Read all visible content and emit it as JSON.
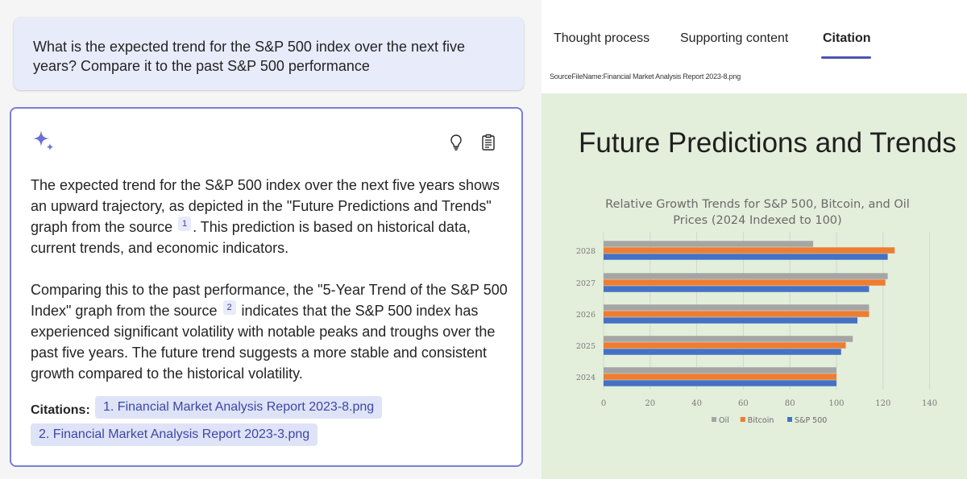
{
  "question": "What is the expected trend for the S&P 500 index over the next five years? Compare it to the past S&P 500 performance",
  "answer": {
    "icons": {
      "sparkle": "sparkle-icon",
      "thought": "lightbulb-icon",
      "supporting": "clipboard-icon"
    },
    "p1_before": "The expected trend for the S&P 500 index over the next five years shows an upward trajectory, as depicted in the \"Future Predictions and Trends\" graph from the source ",
    "p1_ref": "1",
    "p1_after": ". This prediction is based on historical data, current trends, and economic indicators.",
    "p2_before": "Comparing this to the past performance, the \"5-Year Trend of the S&P 500 Index\" graph from the source ",
    "p2_ref": "2",
    "p2_after": " indicates that the S&P 500 index has experienced significant volatility with notable peaks and troughs over the past five years. The future trend suggests a more stable and consistent growth compared to the historical volatility.",
    "citations_label": "Citations:",
    "citations": [
      "1. Financial Market Analysis Report 2023-8.png",
      "2. Financial Market Analysis Report 2023-3.png"
    ]
  },
  "panel": {
    "tabs": [
      "Thought process",
      "Supporting content",
      "Citation"
    ],
    "active_tab": "Citation",
    "source_line": "SourceFileName:Financial Market Analysis Report 2023-8.png",
    "slide_title": "Future Predictions and Trends",
    "accent": "#4f52b2"
  },
  "chart_data": {
    "type": "bar",
    "orientation": "horizontal",
    "title": "Relative Growth Trends for S&P 500, Bitcoin, and Oil Prices (2024 Indexed to 100)",
    "title_lines": [
      "Relative Growth Trends for S&P 500, Bitcoin, and Oil",
      "Prices (2024 Indexed to 100)"
    ],
    "categories": [
      "2024",
      "2025",
      "2026",
      "2027",
      "2028"
    ],
    "series": [
      {
        "name": "Oil",
        "color": "#a5a5a5",
        "values": [
          100,
          107,
          114,
          122,
          90
        ]
      },
      {
        "name": "Bitcoin",
        "color": "#ed7d31",
        "values": [
          100,
          104,
          114,
          121,
          125
        ]
      },
      {
        "name": "S&P 500",
        "color": "#4472c4",
        "values": [
          100,
          102,
          109,
          114,
          122
        ]
      }
    ],
    "xlim": [
      0,
      140
    ],
    "x_ticks": [
      0,
      20,
      40,
      60,
      80,
      100,
      120,
      140
    ],
    "grid": true,
    "legend": "bottom"
  }
}
